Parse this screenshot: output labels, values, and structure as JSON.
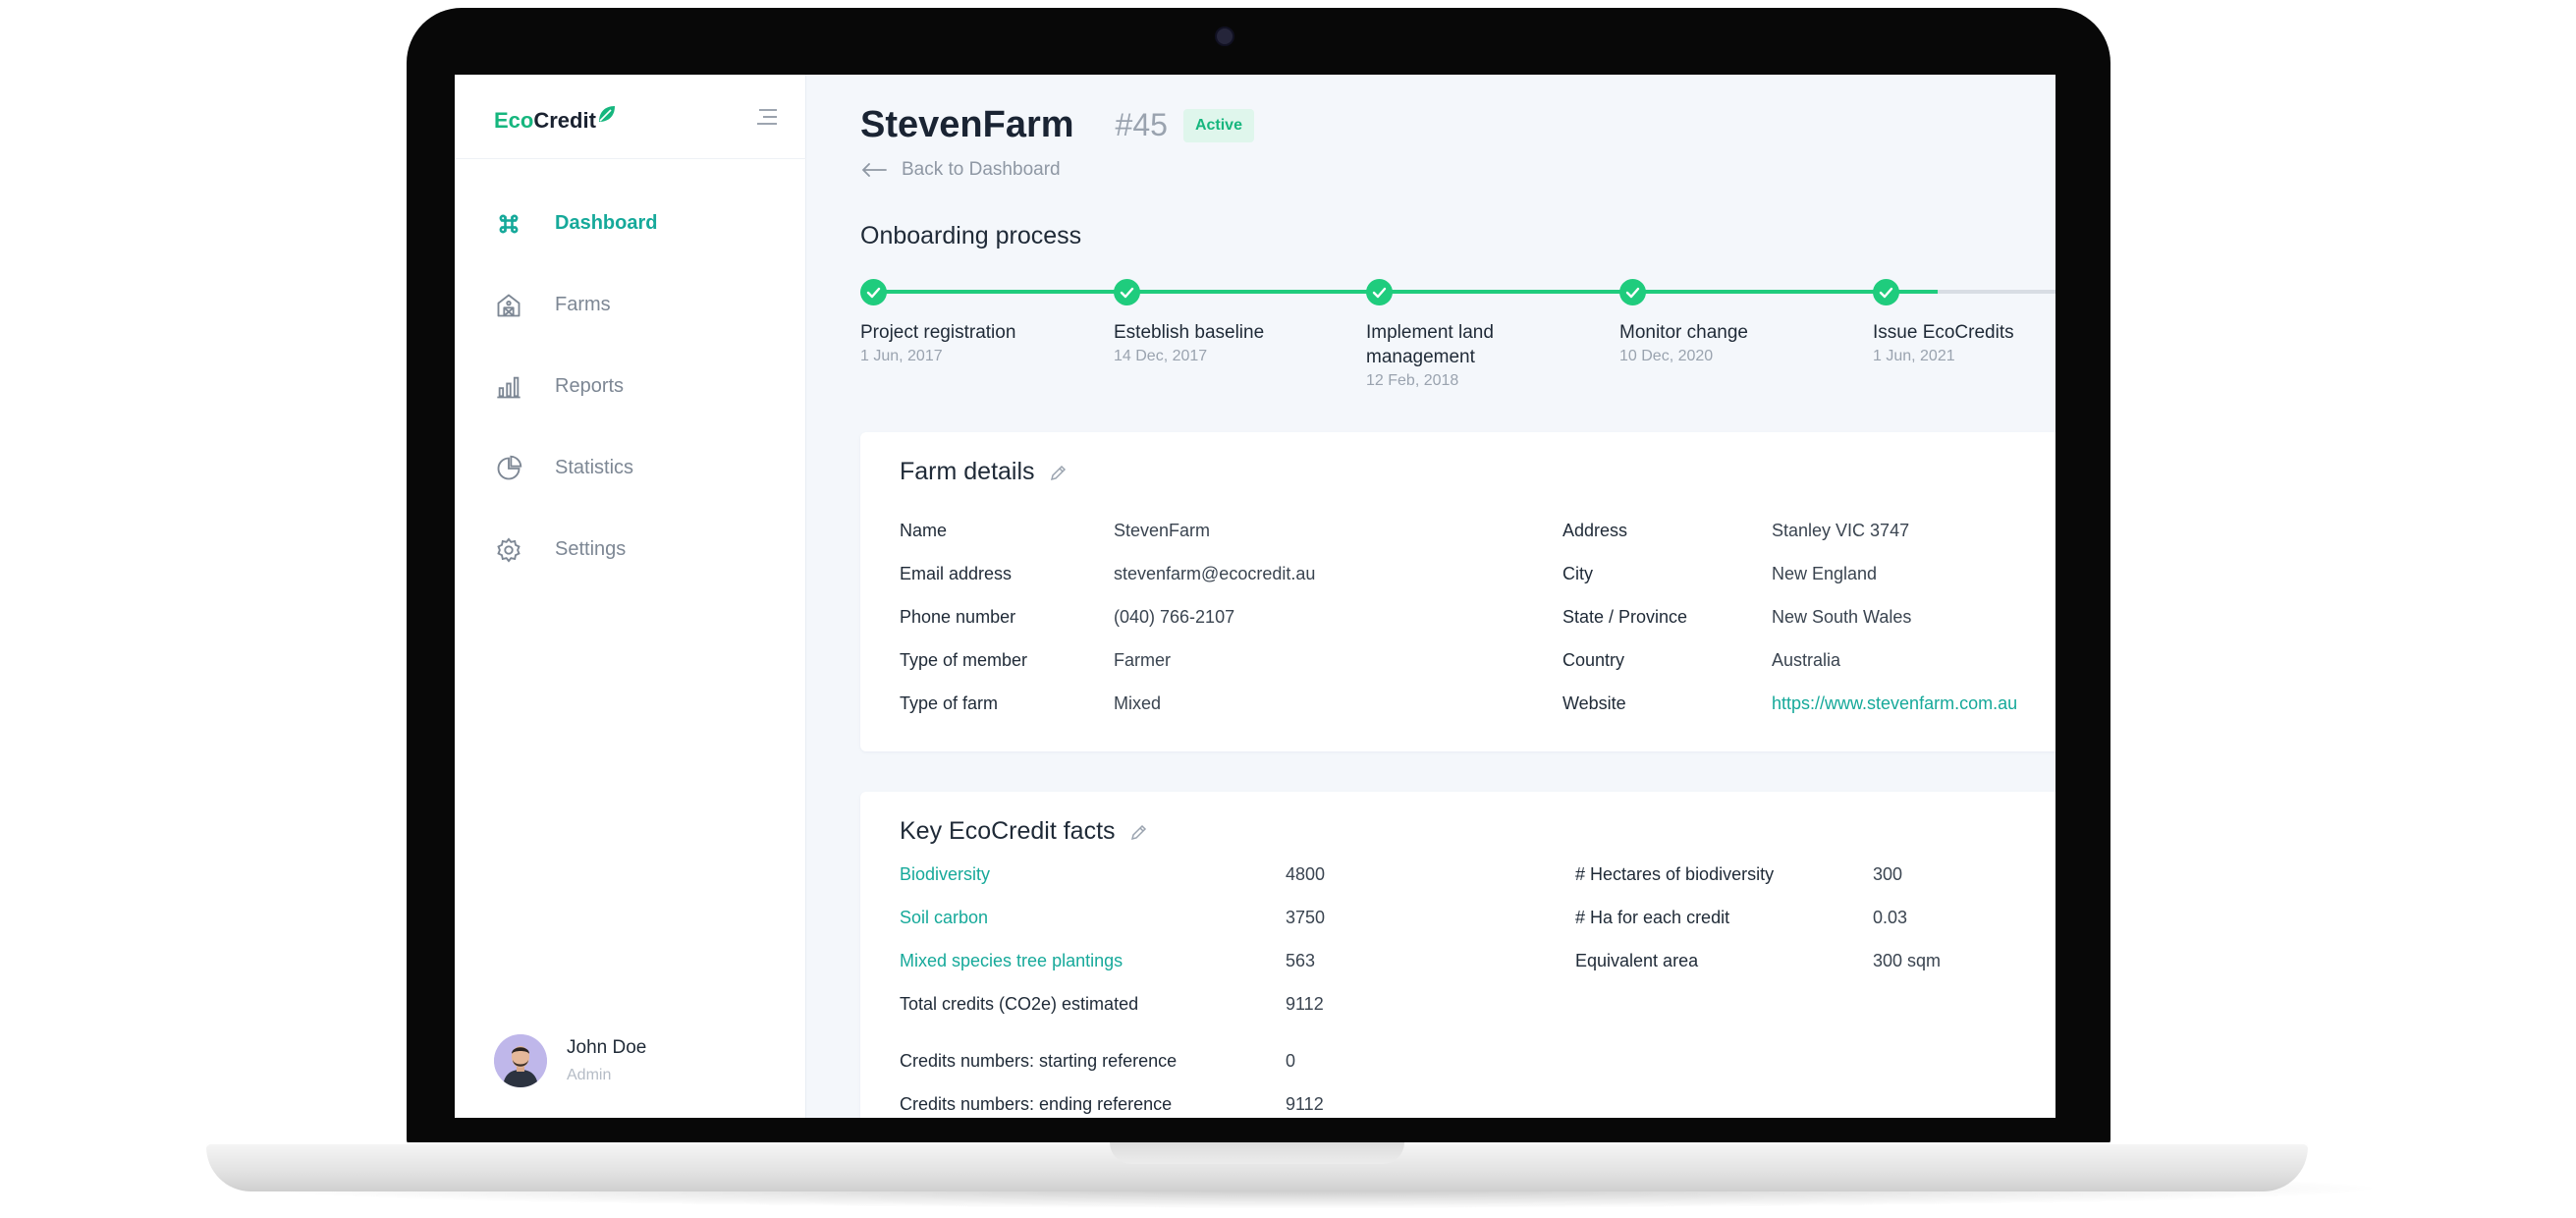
{
  "app": {
    "logo_eco": "Eco",
    "logo_credit": "Credit"
  },
  "sidebar": {
    "items": [
      {
        "label": "Dashboard",
        "icon": "command-icon",
        "active": true
      },
      {
        "label": "Farms",
        "icon": "farm-house-icon",
        "active": false
      },
      {
        "label": "Reports",
        "icon": "bar-chart-icon",
        "active": false
      },
      {
        "label": "Statistics",
        "icon": "pie-chart-icon",
        "active": false
      },
      {
        "label": "Settings",
        "icon": "gear-icon",
        "active": false
      }
    ],
    "user": {
      "name": "John Doe",
      "role": "Admin"
    }
  },
  "header": {
    "title": "StevenFarm",
    "id": "#45",
    "status": "Active",
    "back_label": "Back to Dashboard"
  },
  "onboarding": {
    "title": "Onboarding process",
    "progress": 0.9,
    "steps": [
      {
        "label": "Project registration",
        "date": "1 Jun, 2017"
      },
      {
        "label": "Esteblish baseline",
        "date": "14 Dec, 2017"
      },
      {
        "label": "Implement land management",
        "date": "12 Feb, 2018"
      },
      {
        "label": "Monitor change",
        "date": "10 Dec, 2020"
      },
      {
        "label": "Issue EcoCredits",
        "date": "1 Jun, 2021"
      }
    ]
  },
  "farm_details": {
    "title": "Farm details",
    "left": [
      {
        "key": "Name",
        "value": "StevenFarm"
      },
      {
        "key": "Email address",
        "value": "stevenfarm@ecocredit.au"
      },
      {
        "key": "Phone number",
        "value": "(040) 766-2107"
      },
      {
        "key": "Type of member",
        "value": "Farmer"
      },
      {
        "key": "Type of farm",
        "value": "Mixed"
      }
    ],
    "right": [
      {
        "key": "Address",
        "value": "Stanley VIC 3747"
      },
      {
        "key": "City",
        "value": "New England"
      },
      {
        "key": "State / Province",
        "value": "New South Wales"
      },
      {
        "key": "Country",
        "value": "Australia"
      },
      {
        "key": "Website",
        "value": "https://www.stevenfarm.com.au"
      }
    ]
  },
  "facts": {
    "title": "Key EcoCredit facts",
    "left": [
      {
        "key": "Biodiversity",
        "value": "4800"
      },
      {
        "key": "Soil carbon",
        "value": "3750"
      },
      {
        "key": "Mixed species tree plantings",
        "value": "563"
      },
      {
        "key": "Total credits (CO2e) estimated",
        "value": "9112"
      },
      {
        "key": "Credits numbers: starting reference",
        "value": "0"
      },
      {
        "key": "Credits numbers: ending reference",
        "value": "9112"
      }
    ],
    "right": [
      {
        "key": "# Hectares of biodiversity",
        "value": "300"
      },
      {
        "key": "# Ha for each credit",
        "value": "0.03"
      },
      {
        "key": "Equivalent area",
        "value": "300 sqm"
      }
    ]
  },
  "colors": {
    "brand_green": "#16b67e",
    "accent_teal": "#16a99a",
    "step_green": "#1fcc7d"
  }
}
